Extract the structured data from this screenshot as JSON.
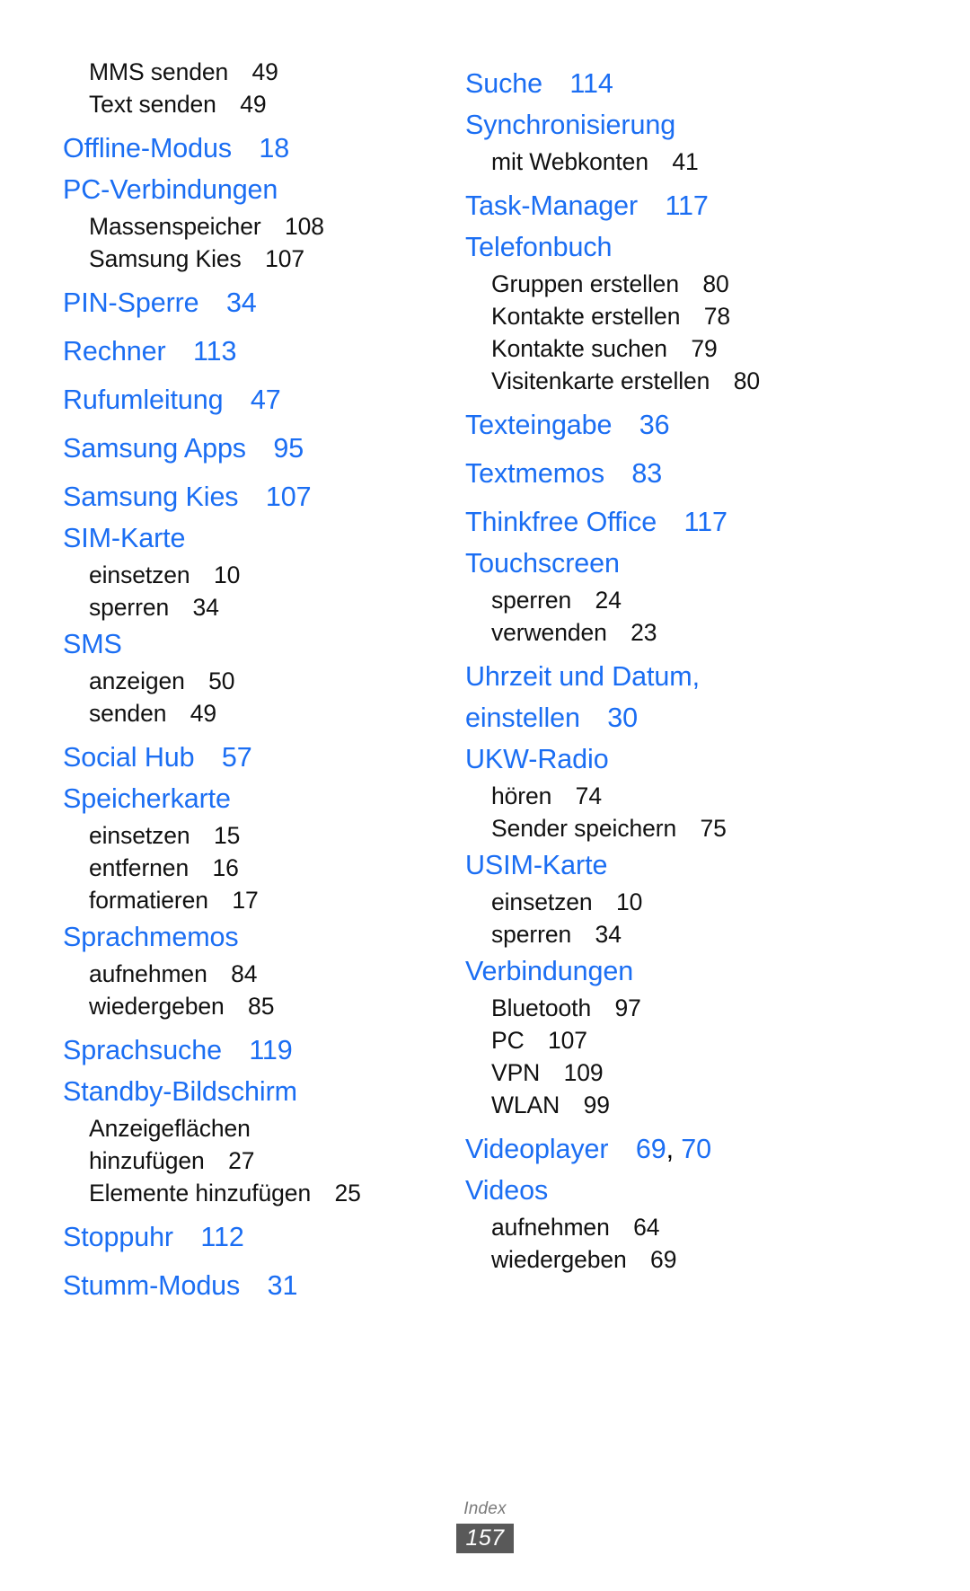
{
  "document": {
    "footer_label": "Index",
    "page_number": "157",
    "accent_color": "#1b6ef3",
    "text_color": "#111111",
    "footer_badge_color": "#595959"
  },
  "left_column": {
    "continued_subentries": [
      {
        "label": "MMS senden",
        "page": "49"
      },
      {
        "label": "Text senden",
        "page": "49"
      }
    ],
    "entries": [
      {
        "head": "Offline-Modus",
        "page": "18",
        "subs": []
      },
      {
        "head": "PC-Verbindungen",
        "page": "",
        "subs": [
          {
            "label": "Massenspeicher",
            "page": "108"
          },
          {
            "label": "Samsung Kies",
            "page": "107"
          }
        ]
      },
      {
        "head": "PIN-Sperre",
        "page": "34",
        "subs": []
      },
      {
        "head": "Rechner",
        "page": "113",
        "subs": []
      },
      {
        "head": "Rufumleitung",
        "page": "47",
        "subs": []
      },
      {
        "head": "Samsung Apps",
        "page": "95",
        "subs": []
      },
      {
        "head": "Samsung Kies",
        "page": "107",
        "subs": []
      },
      {
        "head": "SIM-Karte",
        "page": "",
        "subs": [
          {
            "label": "einsetzen",
            "page": "10"
          },
          {
            "label": "sperren",
            "page": "34"
          }
        ]
      },
      {
        "head": "SMS",
        "page": "",
        "subs": [
          {
            "label": "anzeigen",
            "page": "50"
          },
          {
            "label": "senden",
            "page": "49"
          }
        ]
      },
      {
        "head": "Social Hub",
        "page": "57",
        "subs": []
      },
      {
        "head": "Speicherkarte",
        "page": "",
        "subs": [
          {
            "label": "einsetzen",
            "page": "15"
          },
          {
            "label": "entfernen",
            "page": "16"
          },
          {
            "label": "formatieren",
            "page": "17"
          }
        ]
      },
      {
        "head": "Sprachmemos",
        "page": "",
        "subs": [
          {
            "label": "aufnehmen",
            "page": "84"
          },
          {
            "label": "wiedergeben",
            "page": "85"
          }
        ]
      },
      {
        "head": "Sprachsuche",
        "page": "119",
        "subs": []
      },
      {
        "head": "Standby-Bildschirm",
        "page": "",
        "subs": [
          {
            "label": "Anzeigeflächen",
            "label2": "hinzufügen",
            "page": "27"
          },
          {
            "label": "Elemente hinzufügen",
            "page": "25"
          }
        ]
      },
      {
        "head": "Stoppuhr",
        "page": "112",
        "subs": []
      },
      {
        "head": "Stumm-Modus",
        "page": "31",
        "subs": []
      }
    ]
  },
  "right_column": {
    "entries": [
      {
        "head": "Suche",
        "page": "114",
        "subs": []
      },
      {
        "head": "Synchronisierung",
        "page": "",
        "subs": [
          {
            "label": "mit Webkonten",
            "page": "41"
          }
        ]
      },
      {
        "head": "Task-Manager",
        "page": "117",
        "subs": []
      },
      {
        "head": "Telefonbuch",
        "page": "",
        "subs": [
          {
            "label": "Gruppen erstellen",
            "page": "80"
          },
          {
            "label": "Kontakte erstellen",
            "page": "78"
          },
          {
            "label": "Kontakte suchen",
            "page": "79"
          },
          {
            "label": "Visitenkarte erstellen",
            "page": "80"
          }
        ]
      },
      {
        "head": "Texteingabe",
        "page": "36",
        "subs": []
      },
      {
        "head": "Textmemos",
        "page": "83",
        "subs": []
      },
      {
        "head": "Thinkfree Office",
        "page": "117",
        "subs": []
      },
      {
        "head": "Touchscreen",
        "page": "",
        "subs": [
          {
            "label": "sperren",
            "page": "24"
          },
          {
            "label": "verwenden",
            "page": "23"
          }
        ]
      },
      {
        "head": "Uhrzeit und Datum,",
        "head2": "einstellen",
        "page": "30",
        "subs": []
      },
      {
        "head": "UKW-Radio",
        "page": "",
        "subs": [
          {
            "label": "hören",
            "page": "74"
          },
          {
            "label": "Sender speichern",
            "page": "75"
          }
        ]
      },
      {
        "head": "USIM-Karte",
        "page": "",
        "subs": [
          {
            "label": "einsetzen",
            "page": "10"
          },
          {
            "label": "sperren",
            "page": "34"
          }
        ]
      },
      {
        "head": "Verbindungen",
        "page": "",
        "subs": [
          {
            "label": "Bluetooth",
            "page": "97"
          },
          {
            "label": "PC",
            "page": "107"
          },
          {
            "label": "VPN",
            "page": "109"
          },
          {
            "label": "WLAN",
            "page": "99"
          }
        ]
      },
      {
        "head": "Videoplayer",
        "page": "69, 70",
        "subs": []
      },
      {
        "head": "Videos",
        "page": "",
        "subs": [
          {
            "label": "aufnehmen",
            "page": "64"
          },
          {
            "label": "wiedergeben",
            "page": "69"
          }
        ]
      }
    ]
  }
}
